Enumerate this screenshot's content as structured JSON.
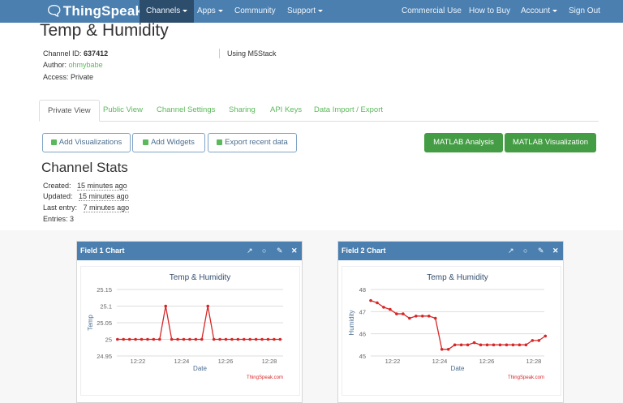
{
  "nav": {
    "brand": "ThingSpeak",
    "tm": "™",
    "items": [
      {
        "label": "Channels"
      },
      {
        "label": "Apps"
      },
      {
        "label": "Community"
      },
      {
        "label": "Support"
      }
    ],
    "right": [
      {
        "label": "Commercial Use"
      },
      {
        "label": "How to Buy"
      },
      {
        "label": "Account"
      },
      {
        "label": "Sign Out"
      }
    ]
  },
  "channel": {
    "title": "Temp & Humidity",
    "id_label": "Channel ID:",
    "id": "637412",
    "author_label": "Author:",
    "author": "ohmybabe",
    "access_label": "Access:",
    "access": "Private",
    "description": "Using M5Stack"
  },
  "tabs": [
    "Private View",
    "Public View",
    "Channel Settings",
    "Sharing",
    "API Keys",
    "Data Import / Export"
  ],
  "buttons": {
    "add_vis": "Add Visualizations",
    "add_widgets": "Add Widgets",
    "export": "Export recent data",
    "matlab_analysis": "MATLAB Analysis",
    "matlab_vis": "MATLAB Visualization"
  },
  "stats": {
    "title": "Channel Stats",
    "created_label": "Created:",
    "created": "15 minutes ago",
    "updated_label": "Updated:",
    "updated": "15 minutes ago",
    "last_label": "Last entry:",
    "last": "7 minutes ago",
    "entries_label": "Entries:",
    "entries": "3"
  },
  "colors": {
    "nav": "#4a7fb0",
    "line": "#d62728",
    "link": "#5cb85c"
  },
  "chart_data": [
    {
      "type": "line",
      "panel_title": "Field 1 Chart",
      "title": "Temp & Humidity",
      "xlabel": "Date",
      "ylabel": "Temp",
      "credit": "ThingSpeak.com",
      "xlim": [
        21.04,
        28.63
      ],
      "ylim": [
        24.95,
        25.15
      ],
      "yticks": [
        24.95,
        25,
        25.05,
        25.1,
        25.15
      ],
      "ytick_labels": [
        "24.95",
        "25",
        "25.05",
        "25.1",
        "25.15"
      ],
      "xticks": [
        22,
        24,
        26,
        28
      ],
      "xtick_labels": [
        "12:22",
        "12:24",
        "12:26",
        "12:28"
      ],
      "x_start": 21.07,
      "x_step": 0.275,
      "values": [
        25,
        25,
        25,
        25,
        25,
        25,
        25,
        25,
        25.1,
        25,
        25,
        25,
        25,
        25,
        25,
        25.1,
        25,
        25,
        25,
        25,
        25,
        25,
        25,
        25,
        25,
        25,
        25,
        25
      ]
    },
    {
      "type": "line",
      "panel_title": "Field 2 Chart",
      "title": "Temp & Humidity",
      "xlabel": "Date",
      "ylabel": "Humidity",
      "credit": "ThingSpeak.com",
      "xlim": [
        21.07,
        28.45
      ],
      "ylim": [
        45,
        48
      ],
      "yticks": [
        45,
        46,
        47,
        48
      ],
      "ytick_labels": [
        "45",
        "46",
        "47",
        "48"
      ],
      "xticks": [
        22,
        24,
        26,
        28
      ],
      "xtick_labels": [
        "12:22",
        "12:24",
        "12:26",
        "12:28"
      ],
      "x_start": 21.07,
      "x_step": 0.275,
      "values": [
        47.5,
        47.4,
        47.2,
        47.1,
        46.9,
        46.9,
        46.7,
        46.8,
        46.8,
        46.8,
        46.7,
        45.3,
        45.3,
        45.5,
        45.5,
        45.5,
        45.6,
        45.5,
        45.5,
        45.5,
        45.5,
        45.5,
        45.5,
        45.5,
        45.5,
        45.7,
        45.7,
        45.9
      ]
    }
  ]
}
